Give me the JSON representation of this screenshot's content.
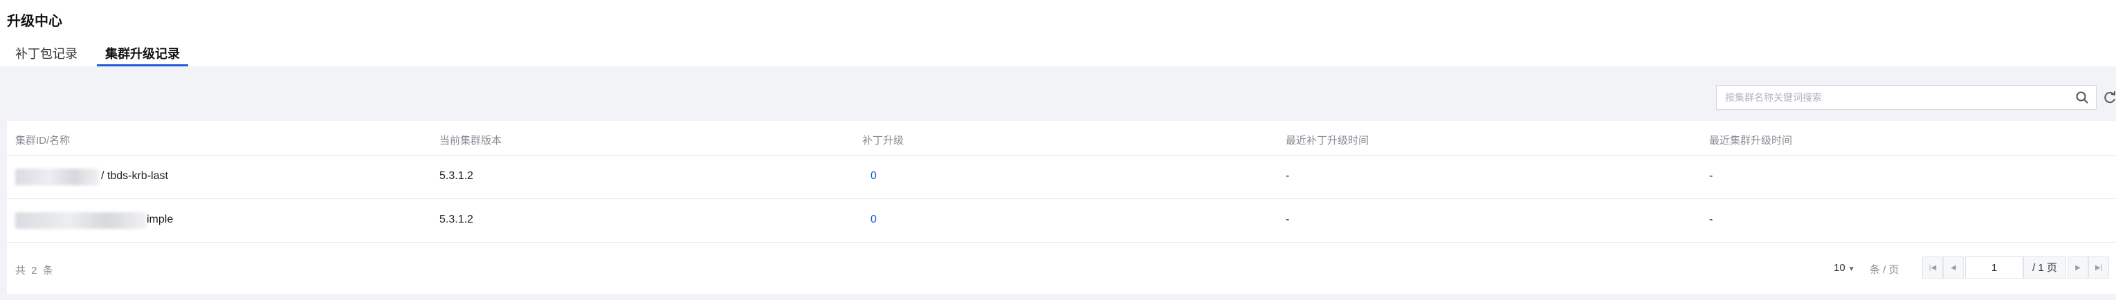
{
  "page": {
    "title": "升级中心"
  },
  "tabs": [
    {
      "label": "补丁包记录"
    },
    {
      "label": "集群升级记录"
    }
  ],
  "search": {
    "placeholder": "按集群名称关键词搜索",
    "value": ""
  },
  "table": {
    "columns": [
      "集群ID/名称",
      "当前集群版本",
      "补丁升级",
      "最近补丁升级时间",
      "最近集群升级时间"
    ],
    "rows": [
      {
        "name": "/ tbds-krb-last",
        "version": "5.3.1.2",
        "patch_upgrades": "0",
        "last_patch_time": "-",
        "last_cluster_time": "-"
      },
      {
        "name": "imple",
        "version": "5.3.1.2",
        "patch_upgrades": "0",
        "last_patch_time": "-",
        "last_cluster_time": "-"
      }
    ]
  },
  "pagination": {
    "total_text": "共 2 条",
    "page_size": "10",
    "per_page_label": "条 / 页",
    "current_page": "1",
    "total_pages_text": "/ 1 页"
  },
  "icons": {
    "search": "search-icon",
    "refresh": "refresh-icon",
    "first": "first-page-icon",
    "prev": "prev-page-icon",
    "next": "next-page-icon",
    "last": "last-page-icon"
  },
  "colors": {
    "accent": "#1f5bd7",
    "background": "#f2f3f6"
  }
}
